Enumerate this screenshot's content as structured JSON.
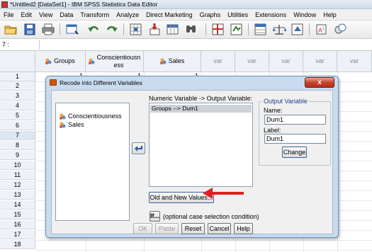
{
  "window": {
    "title": "*Untitled2 [DataSet1] - IBM SPSS Statistics Data Editor"
  },
  "menu": [
    "File",
    "Edit",
    "View",
    "Data",
    "Transform",
    "Analyze",
    "Direct Marketing",
    "Graphs",
    "Utilities",
    "Extensions",
    "Window",
    "Help"
  ],
  "toolbar": {
    "icons": [
      "open-folder-icon",
      "save-icon",
      "print-icon",
      "dialog-recall-icon",
      "undo-icon",
      "redo-icon",
      "goto-case-icon",
      "insert-cases-icon",
      "insert-variable-icon",
      "find-icon",
      "split-file-icon",
      "weight-cases-icon",
      "select-cases-icon",
      "value-labels-icon",
      "use-sets-icon",
      "spelling-icon"
    ]
  },
  "cell_ref": "7 :",
  "grid": {
    "columns": [
      "Groups",
      "Conscientiousness",
      "Sales",
      "var",
      "var",
      "var",
      "var",
      "var"
    ],
    "column_header_lines": [
      [
        "Groups"
      ],
      [
        "Conscientiousn",
        "ess"
      ],
      [
        "Sales"
      ],
      [
        "var"
      ],
      [
        "var"
      ],
      [
        "var"
      ],
      [
        "var"
      ],
      [
        "var"
      ]
    ],
    "rows": [
      "1",
      "2",
      "3",
      "4",
      "5",
      "6",
      "7",
      "8",
      "9",
      "10",
      "11",
      "12",
      "13",
      "14",
      "15",
      "16",
      "17",
      "18"
    ],
    "row1_values": [
      "1",
      "1",
      "1"
    ],
    "active_row": "7"
  },
  "dialog": {
    "title": "Recode into Different Variables",
    "source_variables": [
      "Conscientiousness",
      "Sales"
    ],
    "numeric_variable_label": "Numeric Variable -> Output Variable:",
    "mappings": [
      "Groups --> Dum1"
    ],
    "output_group_title": "Output Variable",
    "name_label": "Name:",
    "name_value": "Dum1",
    "label_label": "Label:",
    "label_value": "Dum1",
    "change_button": "Change",
    "old_new_values_button": "Old and New Values...",
    "if_button": "If...",
    "if_caption": "(optional case selection condition)",
    "buttons": {
      "ok": "OK",
      "paste": "Paste",
      "reset": "Reset",
      "cancel": "Cancel",
      "help": "Help"
    },
    "close_glyph": "x"
  },
  "colors": {
    "title_gradient_start": "#e8eef6",
    "dialog_frame": "#c9dbef",
    "close_red": "#c6442c",
    "callout_arrow": "#e02020",
    "selected_row": "#cdd2d8"
  }
}
